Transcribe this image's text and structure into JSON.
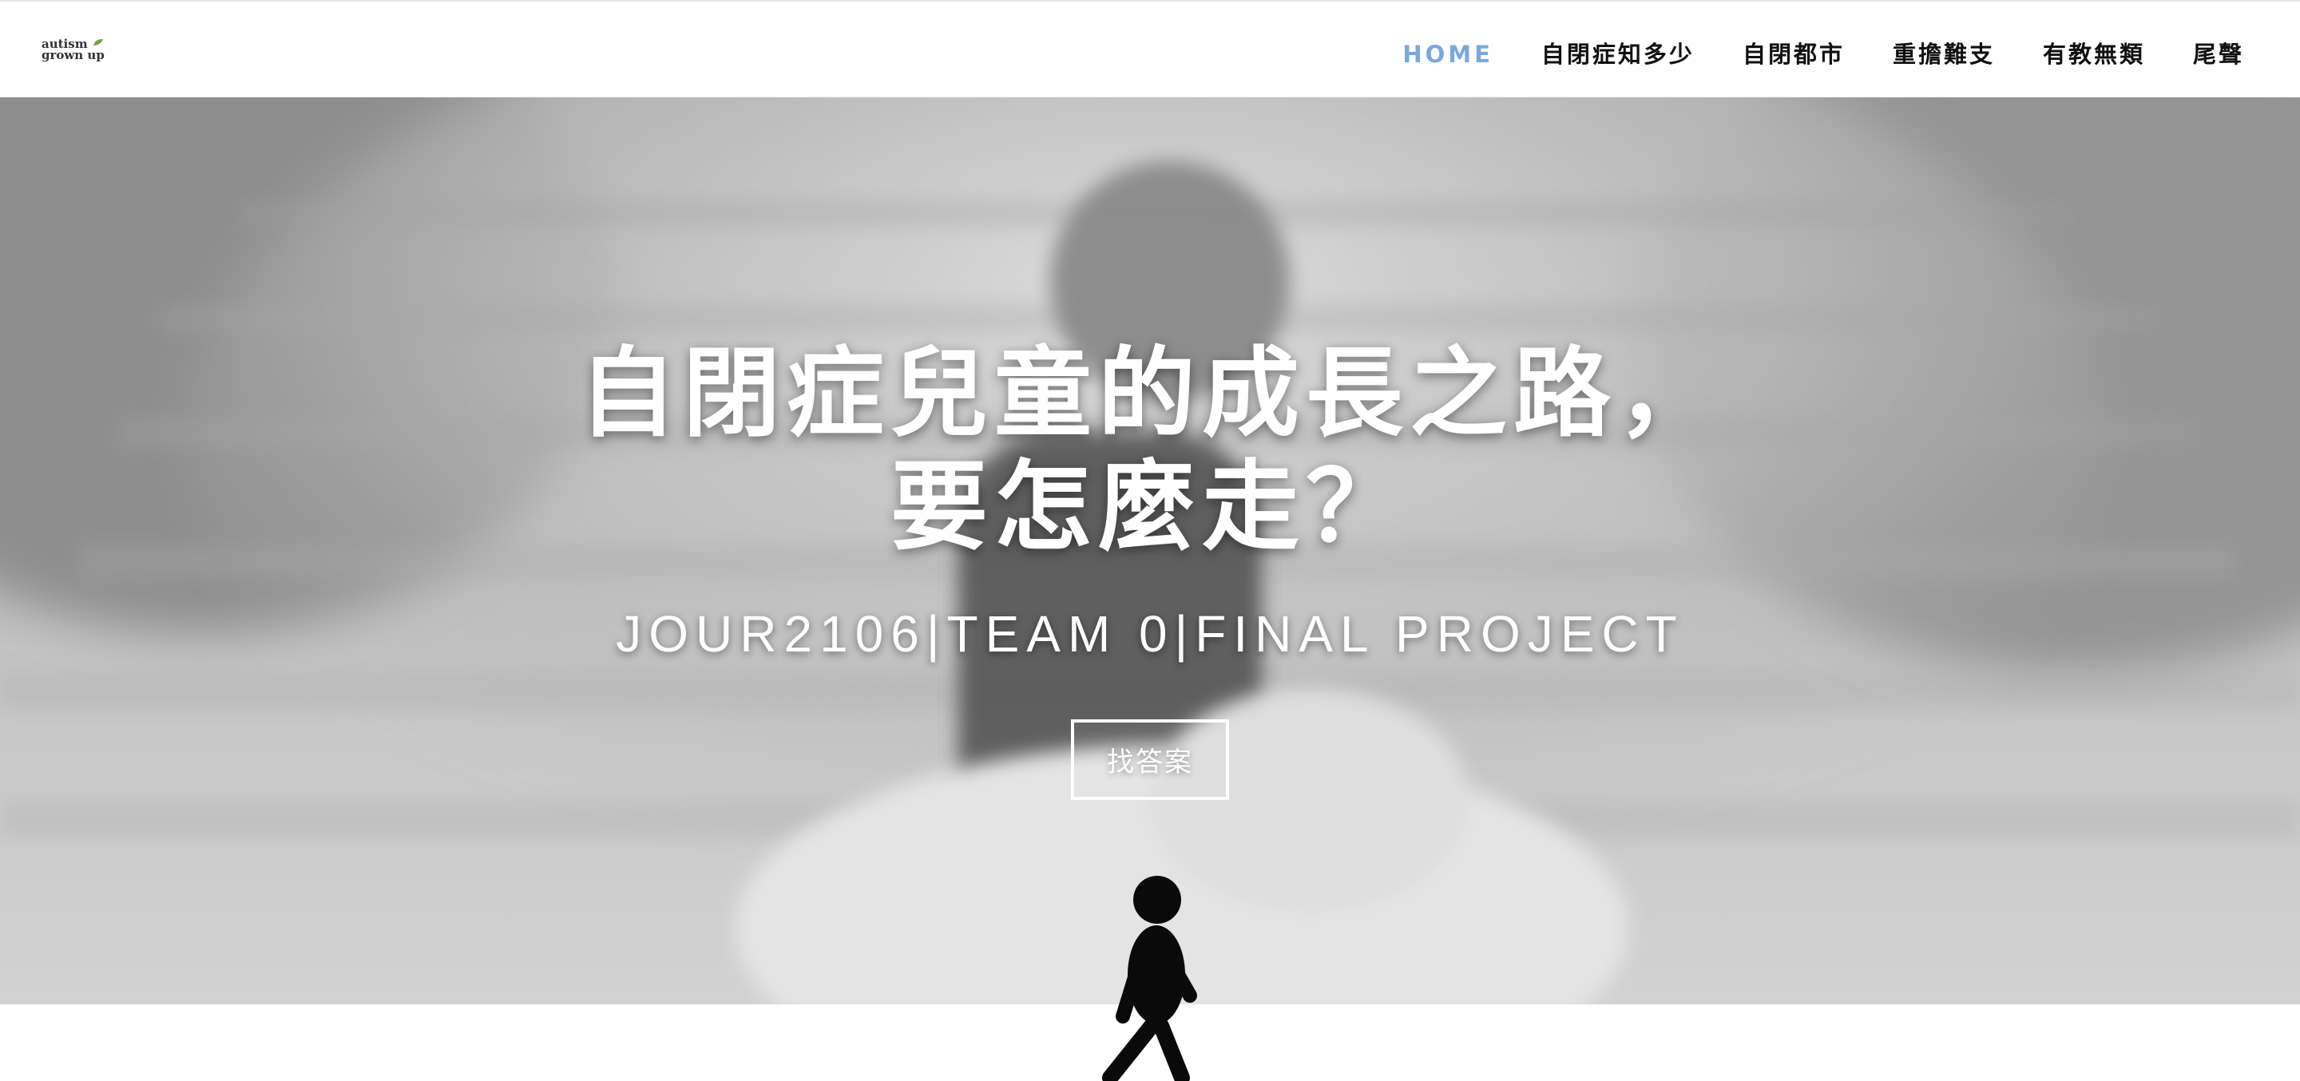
{
  "header": {
    "logo": {
      "line1": "autism",
      "line2": "grown up"
    },
    "nav": [
      {
        "label": "HOME",
        "active": true
      },
      {
        "label": "自閉症知多少",
        "active": false
      },
      {
        "label": "自閉都市",
        "active": false
      },
      {
        "label": "重擔難支",
        "active": false
      },
      {
        "label": "有教無類",
        "active": false
      },
      {
        "label": "尾聲",
        "active": false
      }
    ]
  },
  "hero": {
    "title_line1": "自閉症兒童的成長之路，",
    "title_line2": "要怎麼走？",
    "subtitle": "JOUR2106|TEAM 0|FINAL PROJECT",
    "cta_label": "找答案"
  },
  "colors": {
    "nav_active": "#7aa8dc",
    "nav_text": "#111111",
    "hero_text": "#ffffff",
    "walker": "#0a0a0a"
  },
  "icons": {
    "logo_leaf": "leaf-icon",
    "walker": "walking-person-icon"
  }
}
